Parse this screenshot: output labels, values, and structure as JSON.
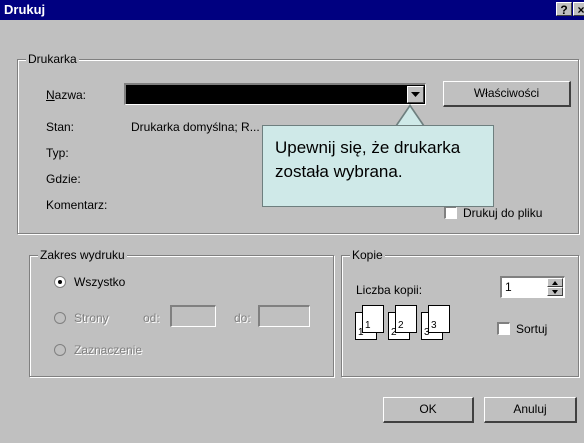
{
  "window": {
    "title": "Drukuj",
    "help_button": "?",
    "close_button": "×"
  },
  "printer": {
    "legend": "Drukarka",
    "name_label": "Nazwa:",
    "name_value": "",
    "properties_button": "Właściwości",
    "status_label": "Stan:",
    "status_value": "Drukarka domyślna; R...",
    "type_label": "Typ:",
    "where_label": "Gdzie:",
    "comment_label": "Komentarz:",
    "print_to_file_label": "Drukuj do pliku"
  },
  "tooltip": {
    "text": "Upewnij się, że drukarka została wybrana."
  },
  "range": {
    "legend": "Zakres wydruku",
    "all_label": "Wszystko",
    "pages_label": "Strony",
    "from_label": "od:",
    "to_label": "do:",
    "selection_label": "Zaznaczenie"
  },
  "copies": {
    "legend": "Kopie",
    "count_label": "Liczba kopii:",
    "count_value": "1",
    "collate_label": "Sortuj",
    "icon_labels": [
      "1",
      "1",
      "2",
      "2",
      "3",
      "3"
    ]
  },
  "buttons": {
    "ok": "OK",
    "cancel": "Anuluj"
  }
}
